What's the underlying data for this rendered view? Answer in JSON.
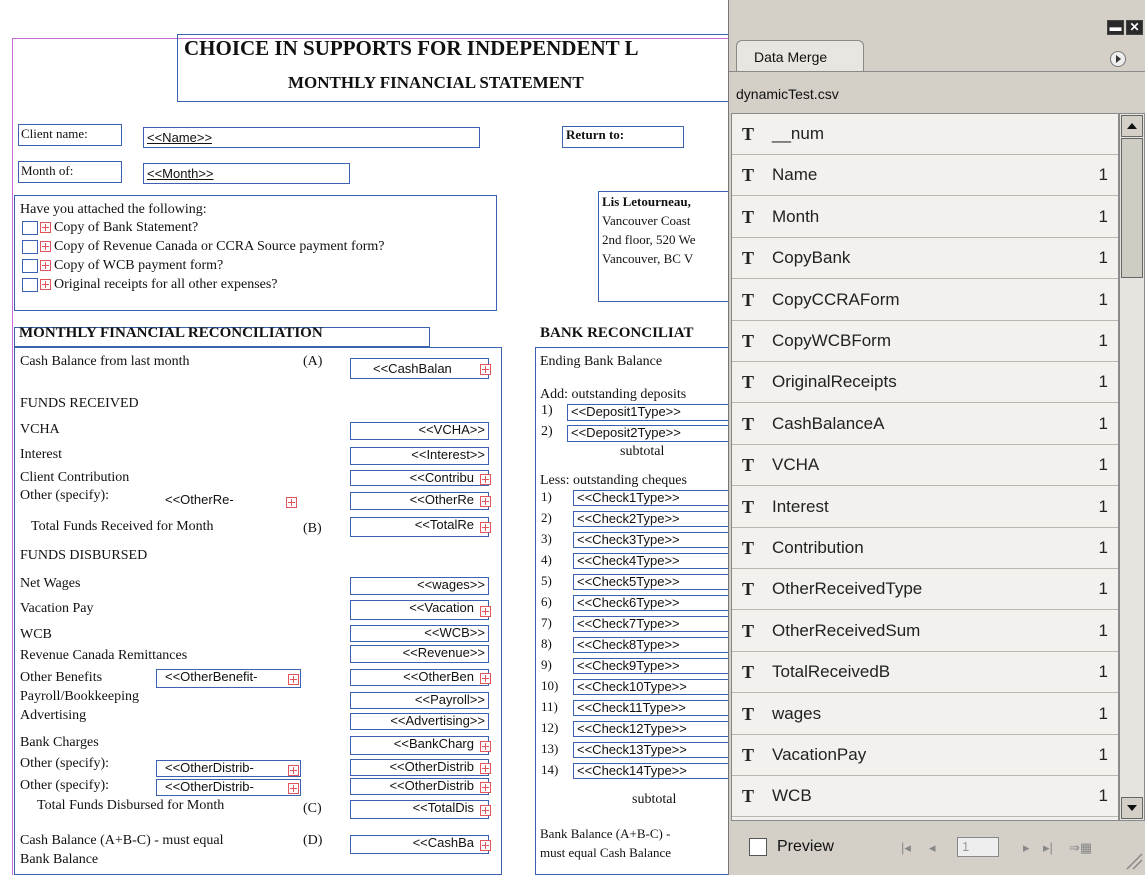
{
  "form": {
    "title1": "CHOICE IN SUPPORTS FOR INDEPENDENT L",
    "title2": "MONTHLY FINANCIAL STATEMENT",
    "client_name_label": "Client name:",
    "client_name_value": "<<Name>>",
    "month_label": "Month of:",
    "month_value": "<<Month>>",
    "return_label": "Return to:",
    "attach_title": "Have you attached the following:",
    "attach_items": [
      "Copy of Bank Statement?",
      "Copy of Revenue Canada or CCRA Source payment form?",
      "Copy of WCB payment form?",
      "Original receipts for all other expenses?"
    ],
    "address_lines": [
      "Lis Letourneau,",
      "Vancouver Coast",
      "2nd floor, 520 We",
      "Vancouver, BC V"
    ],
    "recon_title": "MONTHLY FINANCIAL RECONCILIATION",
    "bank_title": "BANK RECONCILIAT",
    "cash_last_label": "Cash Balance from last month",
    "label_A": "(A)",
    "cash_last_value": "<<CashBalan",
    "funds_received": "FUNDS RECEIVED",
    "vcha_label": "VCHA",
    "vcha_value": "<<VCHA>>",
    "interest_label": "Interest",
    "interest_value": "<<Interest>>",
    "contrib_label": "Client Contribution",
    "contrib_value": "<<Contribu",
    "other_label": "Other (specify):",
    "other_type_value": "<<OtherRe-",
    "other_sum_value": "<<OtherRe",
    "total_received_label": "Total Funds Received for Month",
    "label_B": "(B)",
    "total_received_value": "<<TotalRe",
    "funds_disbursed": "FUNDS DISBURSED",
    "net_wages_label": "Net Wages",
    "net_wages_value": "<<wages>>",
    "vacation_label": "Vacation Pay",
    "vacation_value": "<<Vacation",
    "wcb_label": "WCB",
    "wcb_value": "<<WCB>>",
    "revenue_label": "Revenue Canada Remittances",
    "revenue_value": "<<Revenue>>",
    "other_benefits_label": "Other Benefits",
    "other_benefits_type": "<<OtherBenefit-",
    "other_benefits_value": "<<OtherBen",
    "payroll_label": "Payroll/Bookkeeping",
    "payroll_value": "<<Payroll>>",
    "advertising_label": "Advertising",
    "advertising_value": "<<Advertising>>",
    "bank_charges_label": "Bank Charges",
    "bank_charges_value": "<<BankCharg",
    "other_distrib_label1": "Other (specify):",
    "other_distrib_type1": "<<OtherDistrib-",
    "other_distrib_value1": "<<OtherDistrib",
    "other_distrib_label2": "Other (specify):",
    "other_distrib_type2": "<<OtherDistrib-",
    "other_distrib_value2": "<<OtherDistrib",
    "total_disbursed_label": "Total Funds Disbursed for Month",
    "label_C": "(C)",
    "total_disbursed_value": "<<TotalDis",
    "cash_balance_label": "Cash Balance (A+B-C) - must equal",
    "cash_balance_label2": "Bank Balance",
    "label_D": "(D)",
    "cash_balance_value": "<<CashBa",
    "ending_bank": "Ending Bank Balance",
    "add_deposits": "Add: outstanding deposits",
    "deposits": [
      {
        "num": "1)",
        "value": "<<Deposit1Type>>"
      },
      {
        "num": "2)",
        "value": "<<Deposit2Type>>"
      }
    ],
    "subtotal": "subtotal",
    "less_cheques": "Less: outstanding cheques",
    "checks": [
      {
        "num": "1)",
        "value": "<<Check1Type>>"
      },
      {
        "num": "2)",
        "value": "<<Check2Type>>"
      },
      {
        "num": "3)",
        "value": "<<Check3Type>>"
      },
      {
        "num": "4)",
        "value": "<<Check4Type>>"
      },
      {
        "num": "5)",
        "value": "<<Check5Type>>"
      },
      {
        "num": "6)",
        "value": "<<Check6Type>>"
      },
      {
        "num": "7)",
        "value": "<<Check7Type>>"
      },
      {
        "num": "8)",
        "value": "<<Check8Type>>"
      },
      {
        "num": "9)",
        "value": "<<Check9Type>>"
      },
      {
        "num": "10)",
        "value": "<<Check10Type>>"
      },
      {
        "num": "11)",
        "value": "<<Check11Type>>"
      },
      {
        "num": "12)",
        "value": "<<Check12Type>>"
      },
      {
        "num": "13)",
        "value": "<<Check13Type>>"
      },
      {
        "num": "14)",
        "value": "<<Check14Type>>"
      }
    ],
    "subtotal2": "subtotal",
    "bank_balance_label": "Bank Balance (A+B-C) -",
    "bank_balance_label2": "must equal Cash Balance"
  },
  "panel": {
    "tab_label": "Data Merge",
    "source_file": "dynamicTest.csv",
    "fields": [
      {
        "name": "__num",
        "count": ""
      },
      {
        "name": "Name",
        "count": "1"
      },
      {
        "name": "Month",
        "count": "1"
      },
      {
        "name": "CopyBank",
        "count": "1"
      },
      {
        "name": "CopyCCRAForm",
        "count": "1"
      },
      {
        "name": "CopyWCBForm",
        "count": "1"
      },
      {
        "name": "OriginalReceipts",
        "count": "1"
      },
      {
        "name": "CashBalanceA",
        "count": "1"
      },
      {
        "name": "VCHA",
        "count": "1"
      },
      {
        "name": "Interest",
        "count": "1"
      },
      {
        "name": "Contribution",
        "count": "1"
      },
      {
        "name": "OtherReceivedType",
        "count": "1"
      },
      {
        "name": "OtherReceivedSum",
        "count": "1"
      },
      {
        "name": "TotalReceivedB",
        "count": "1"
      },
      {
        "name": "wages",
        "count": "1"
      },
      {
        "name": "VacationPay",
        "count": "1"
      },
      {
        "name": "WCB",
        "count": "1"
      }
    ],
    "field_type_glyph": "T",
    "preview_label": "Preview",
    "page_value": "1",
    "minimize_glyph": "▬",
    "close_glyph": "✕"
  }
}
